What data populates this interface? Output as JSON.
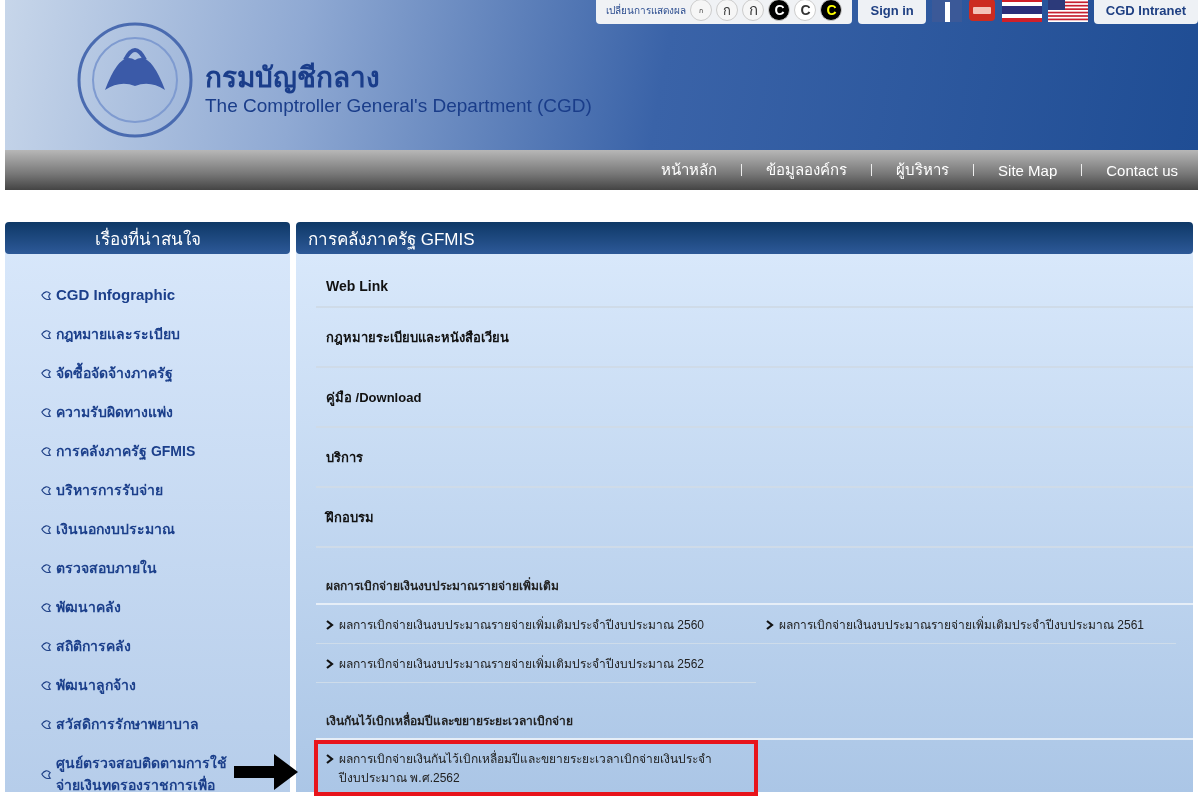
{
  "header": {
    "display_label": "เปลี่ยนการแสดงผล",
    "font_buttons": [
      {
        "label": "ก",
        "kind": "small"
      },
      {
        "label": "ก",
        "kind": "medium"
      },
      {
        "label": "ก",
        "kind": "large"
      }
    ],
    "contrast_buttons": [
      {
        "label": "C",
        "kind": "dark"
      },
      {
        "label": "C",
        "kind": "light"
      },
      {
        "label": "C",
        "kind": "yellow"
      }
    ],
    "sign_in": "Sign in",
    "intranet": "CGD Intranet",
    "title": "กรมบัญชีกลาง",
    "subtitle": "The Comptroller General's Department (CGD)"
  },
  "nav": [
    "หน้าหลัก",
    "ข้อมูลองค์กร",
    "ผู้บริหาร",
    "Site Map",
    "Contact us"
  ],
  "sidebar": {
    "title": "เรื่องที่น่าสนใจ",
    "items": [
      {
        "label": "CGD Infographic"
      },
      {
        "label": "กฎหมายและระเบียบ"
      },
      {
        "label": "จัดซื้อจัดจ้างภาครัฐ"
      },
      {
        "label": "ความรับผิดทางแพ่ง"
      },
      {
        "label": "การคลังภาครัฐ GFMIS"
      },
      {
        "label": "บริหารการรับจ่าย"
      },
      {
        "label": "เงินนอกงบประมาณ"
      },
      {
        "label": "ตรวจสอบภายใน"
      },
      {
        "label": "พัฒนาคลัง"
      },
      {
        "label": "สถิติการคลัง"
      },
      {
        "label": "พัฒนาลูกจ้าง"
      },
      {
        "label": "สวัสดิการรักษาพยาบาล"
      },
      {
        "label": "ศูนย์ตรวจสอบติดตามการใช้จ่ายเงินทดรองราชการเพื่อ"
      }
    ]
  },
  "content": {
    "title": "การคลังภาครัฐ GFMIS",
    "categories": [
      "Web Link",
      "กฎหมายระเบียบและหนังสือเวียน",
      "คู่มือ /Download",
      "บริการ",
      "ฝึกอบรม"
    ],
    "sections": [
      {
        "title": "ผลการเบิกจ่ายเงินงบประมาณรายจ่ายเพิ่มเติม",
        "links": [
          {
            "label": "ผลการเบิกจ่ายเงินงบประมาณรายจ่ายเพิ่มเติมประจำปีงบประมาณ 2560",
            "highlighted": false
          },
          {
            "label": "ผลการเบิกจ่ายเงินงบประมาณรายจ่ายเพิ่มเติมประจำปีงบประมาณ 2561",
            "highlighted": false
          },
          {
            "label": "ผลการเบิกจ่ายเงินงบประมาณรายจ่ายเพิ่มเติมประจำปีงบประมาณ 2562",
            "highlighted": false
          }
        ]
      },
      {
        "title": "เงินกันไว้เบิกเหลื่อมปีและขยายระยะเวลาเบิกจ่าย",
        "links": [
          {
            "label": "ผลการเบิกจ่ายเงินกันไว้เบิกเหลื่อมปีและขยายระยะเวลาเบิกจ่ายเงินประจำปีงบประมาณ พ.ศ.2562",
            "highlighted": true
          }
        ]
      }
    ]
  }
}
